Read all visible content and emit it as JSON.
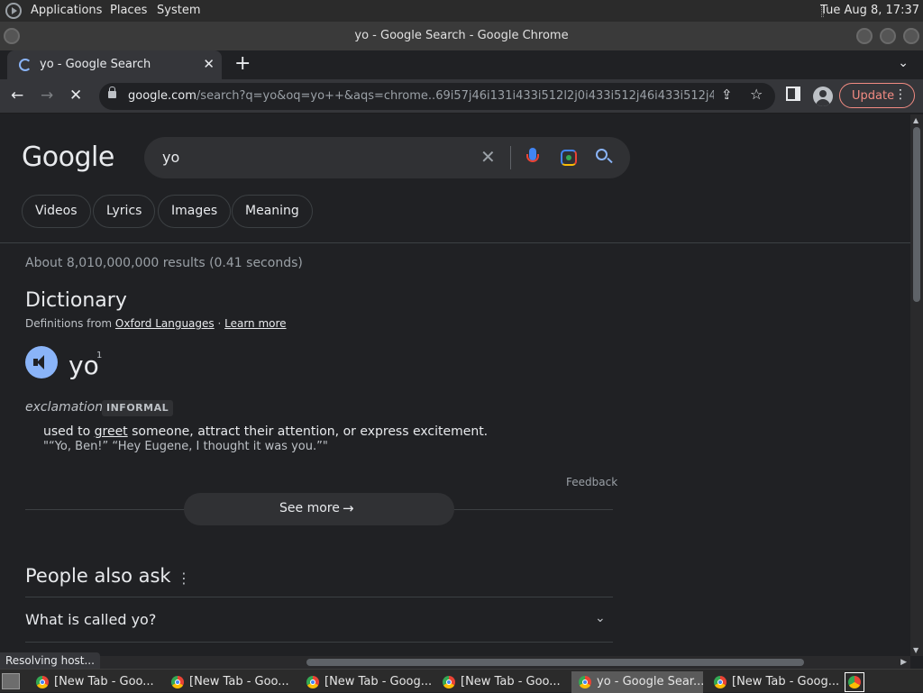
{
  "panel": {
    "menus": [
      "Applications",
      "Places",
      "System"
    ],
    "clock": "Tue Aug  8, 17:37"
  },
  "window": {
    "title": "yo - Google Search - Google Chrome"
  },
  "tab": {
    "label": "yo - Google Search",
    "close": "✕"
  },
  "toolbar": {
    "url_host": "google.com",
    "url_rest": "/search?q=yo&oq=yo++&aqs=chrome..69i57j46i131i433i512l2j0i433i512j46i433i512j46i131i...",
    "update_label": "Update"
  },
  "search": {
    "logo": "Google",
    "query": "yo",
    "chips": [
      "Videos",
      "Lyrics",
      "Images",
      "Meaning"
    ],
    "stats": "About 8,010,000,000 results (0.41 seconds)"
  },
  "dictionary": {
    "title": "Dictionary",
    "defs_prefix": "Definitions from ",
    "source": "Oxford Languages",
    "sep": " · ",
    "learn_more": "Learn more",
    "word": "yo",
    "sup": "1",
    "pos": "exclamation",
    "register": "INFORMAL",
    "def_before": "used to ",
    "def_link": "greet",
    "def_after": " someone, attract their attention, or express excitement.",
    "example": "\"“Yo, Ben!” “Hey Eugene, I thought it was you.”\"",
    "feedback": "Feedback",
    "see_more": "See more"
  },
  "paa": {
    "title": "People also ask",
    "question": "What is called yo?"
  },
  "status": "Resolving host...",
  "taskbar": {
    "items": [
      "[New Tab - Goo...",
      "[New Tab - Goo...",
      "[New Tab - Goog...",
      "[New Tab - Goo...",
      "yo - Google Sear...",
      "[New Tab - Goog..."
    ]
  }
}
